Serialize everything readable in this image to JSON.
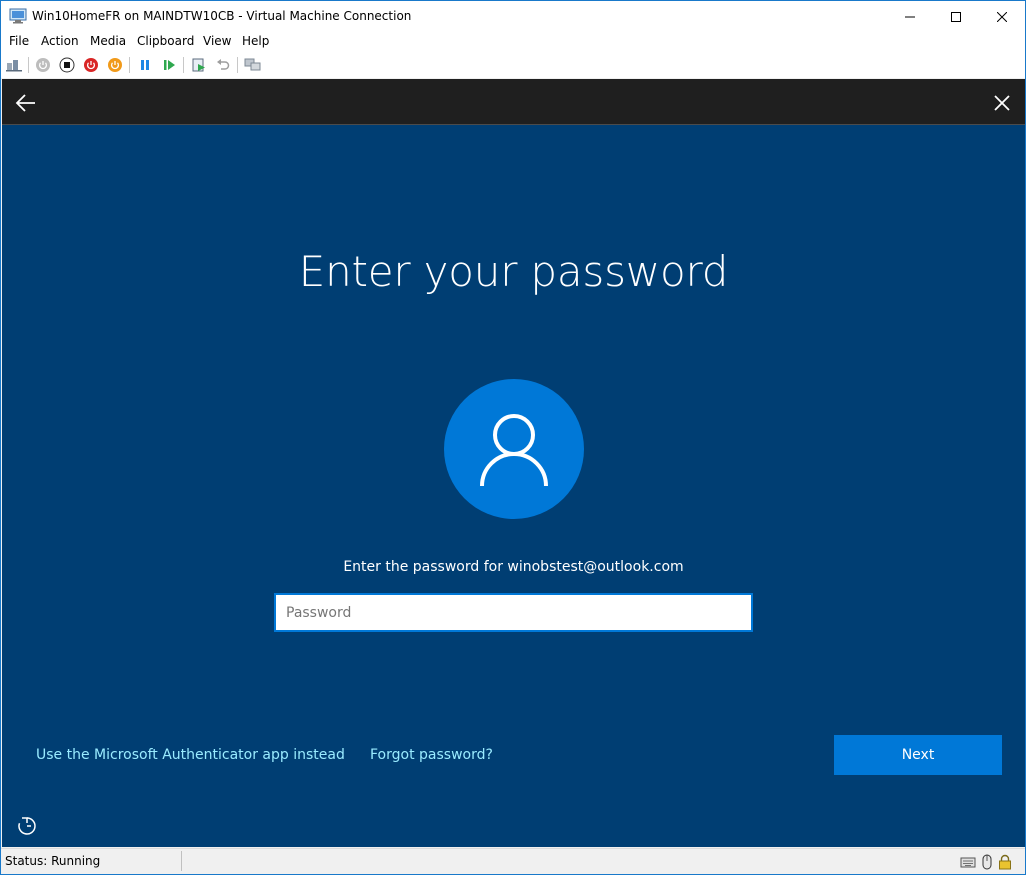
{
  "window": {
    "title": "Win10HomeFR on MAINDTW10CB - Virtual Machine Connection",
    "icon": "vm-connection-icon",
    "controls": [
      "minimize-icon",
      "maximize-icon",
      "close-icon"
    ]
  },
  "menu": {
    "items": [
      "File",
      "Action",
      "Media",
      "Clipboard",
      "View",
      "Help"
    ]
  },
  "toolbar": {
    "buttons": [
      "ctrl-alt-del-icon",
      "start-icon",
      "turn-off-icon",
      "shutdown-icon",
      "save-state-icon",
      "pause-icon",
      "resume-icon",
      "checkpoint-icon",
      "revert-icon",
      "enhanced-session-icon"
    ]
  },
  "vm": {
    "heading": "Enter your password",
    "prompt": "Enter the password for winobstest@outlook.com",
    "password": {
      "value": "",
      "placeholder": "Password"
    },
    "authenticator_link": "Use the Microsoft Authenticator app instead",
    "forgot_link": "Forgot password?",
    "next_label": "Next",
    "colors": {
      "background": "#003e73",
      "bars": "#1f1f1f",
      "accent": "#0078d7"
    }
  },
  "status": {
    "text": "Status: Running",
    "icons": [
      "keyboard-icon",
      "mouse-icon",
      "lock-icon"
    ]
  }
}
